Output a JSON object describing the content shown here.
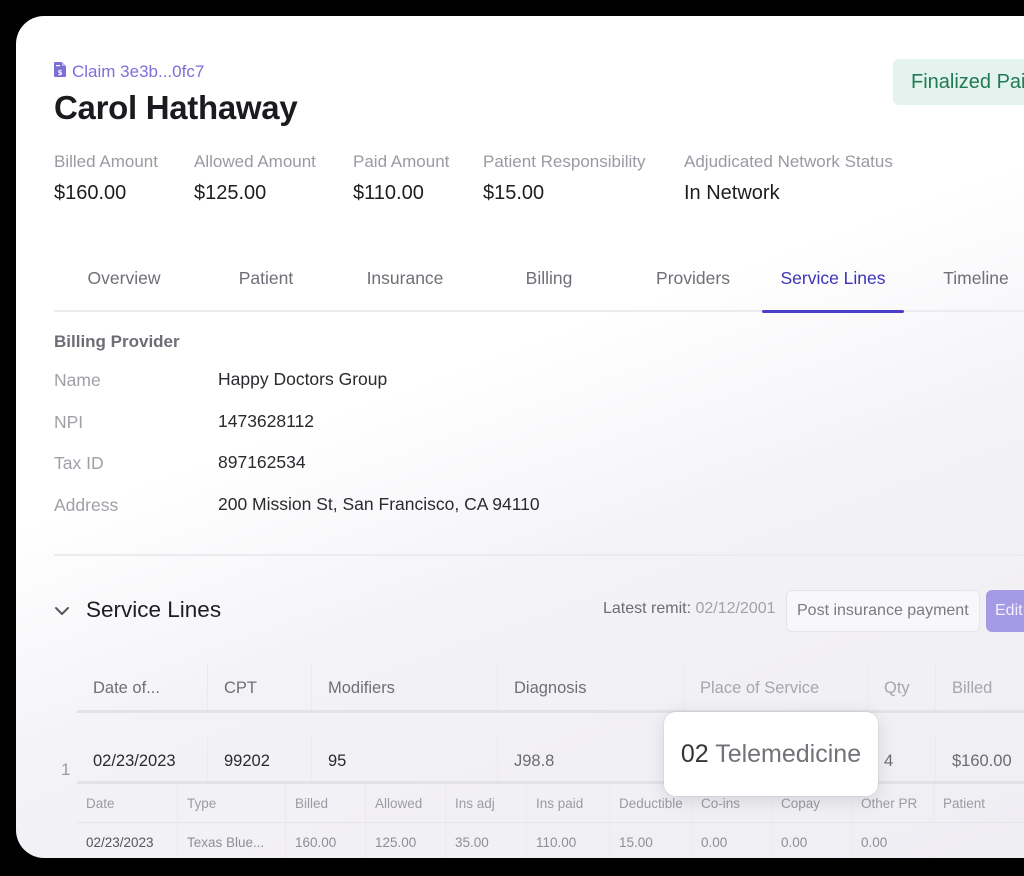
{
  "header": {
    "claim_link": "Claim 3e3b...0fc7",
    "claim_icon": "document-dollar-icon",
    "patient_name": "Carol Hathaway",
    "status_badge": "Finalized Paid",
    "colors": {
      "accent": "#4a3fc6",
      "link": "#7d6fd8",
      "status_bg": "#e4f3ee",
      "status_text": "#1f7a55"
    }
  },
  "summary": [
    {
      "label": "Billed Amount",
      "value": "$160.00"
    },
    {
      "label": "Allowed Amount",
      "value": "$125.00"
    },
    {
      "label": "Paid Amount",
      "value": "$110.00"
    },
    {
      "label": "Patient Responsibility",
      "value": "$15.00"
    },
    {
      "label": "Adjudicated Network Status",
      "value": "In Network"
    }
  ],
  "tabs": [
    {
      "label": "Overview",
      "active": false
    },
    {
      "label": "Patient",
      "active": false
    },
    {
      "label": "Insurance",
      "active": false
    },
    {
      "label": "Billing",
      "active": false
    },
    {
      "label": "Providers",
      "active": false
    },
    {
      "label": "Service Lines",
      "active": true
    },
    {
      "label": "Timeline",
      "active": false
    }
  ],
  "billing_provider": {
    "title": "Billing Provider",
    "fields": [
      {
        "label": "Name",
        "value": "Happy Doctors Group"
      },
      {
        "label": "NPI",
        "value": "1473628112"
      },
      {
        "label": "Tax ID",
        "value": "897162534"
      },
      {
        "label": "Address",
        "value": "200 Mission St, San Francisco, CA 94110"
      }
    ]
  },
  "service_lines": {
    "title": "Service Lines",
    "latest_remit_label": "Latest remit:",
    "latest_remit_date": "02/12/2001",
    "post_payment_button": "Post insurance payment",
    "edit_button": "Edit",
    "columns": [
      "Date of...",
      "CPT",
      "Modifiers",
      "Diagnosis",
      "Place of Service",
      "Qty",
      "Billed"
    ],
    "rows": [
      {
        "index": "1",
        "cells": [
          "02/23/2023",
          "99202",
          "95",
          "J98.8",
          "02 Telemedicine",
          "4",
          "$160.00"
        ]
      }
    ],
    "remit_columns": [
      "Date",
      "Type",
      "Billed",
      "Allowed",
      "Ins adj",
      "Ins paid",
      "Deductible",
      "Co-ins",
      "Copay",
      "Other PR",
      "Patient"
    ],
    "remit_rows": [
      [
        "02/23/2023",
        "Texas Blue...",
        "160.00",
        "125.00",
        "35.00",
        "110.00",
        "15.00",
        "0.00",
        "0.00",
        "0.00",
        ""
      ]
    ],
    "popover": {
      "code": "02",
      "label": "Telemedicine"
    }
  }
}
